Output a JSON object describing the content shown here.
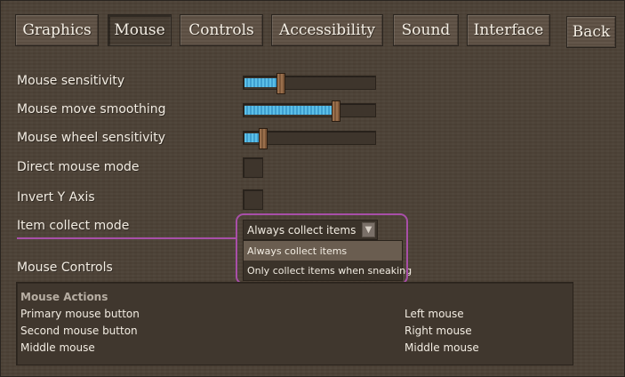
{
  "tabs": [
    {
      "label": "Graphics",
      "active": false
    },
    {
      "label": "Mouse",
      "active": true
    },
    {
      "label": "Controls",
      "active": false
    },
    {
      "label": "Accessibility",
      "active": false
    },
    {
      "label": "Sound",
      "active": false
    },
    {
      "label": "Interface",
      "active": false
    }
  ],
  "back_label": "Back",
  "settings": {
    "mouse_sensitivity": {
      "label": "Mouse sensitivity",
      "value": 0.27
    },
    "mouse_move_smoothing": {
      "label": "Mouse move smoothing",
      "value": 0.72
    },
    "mouse_wheel_sensitivity": {
      "label": "Mouse wheel sensitivity",
      "value": 0.12
    },
    "direct_mouse_mode": {
      "label": "Direct mouse mode",
      "checked": false
    },
    "invert_y_axis": {
      "label": "Invert Y Axis",
      "checked": false
    },
    "item_collect_mode": {
      "label": "Item collect mode",
      "selected": "Always collect items",
      "options": [
        "Always collect items",
        "Only collect items when sneaking"
      ]
    }
  },
  "mouse_controls": {
    "section_label": "Mouse Controls",
    "panel_header": "Mouse Actions",
    "actions": [
      {
        "action": "Primary mouse button",
        "binding": "Left mouse"
      },
      {
        "action": "Second mouse button",
        "binding": "Right mouse"
      },
      {
        "action": "Middle mouse",
        "binding": "Middle mouse"
      }
    ]
  },
  "colors": {
    "highlight": "#a84fa8",
    "slider_fill": "#4fb0e0",
    "background": "#4c4136"
  },
  "icons": {
    "dropdown_arrow": "triangle-down-icon"
  }
}
